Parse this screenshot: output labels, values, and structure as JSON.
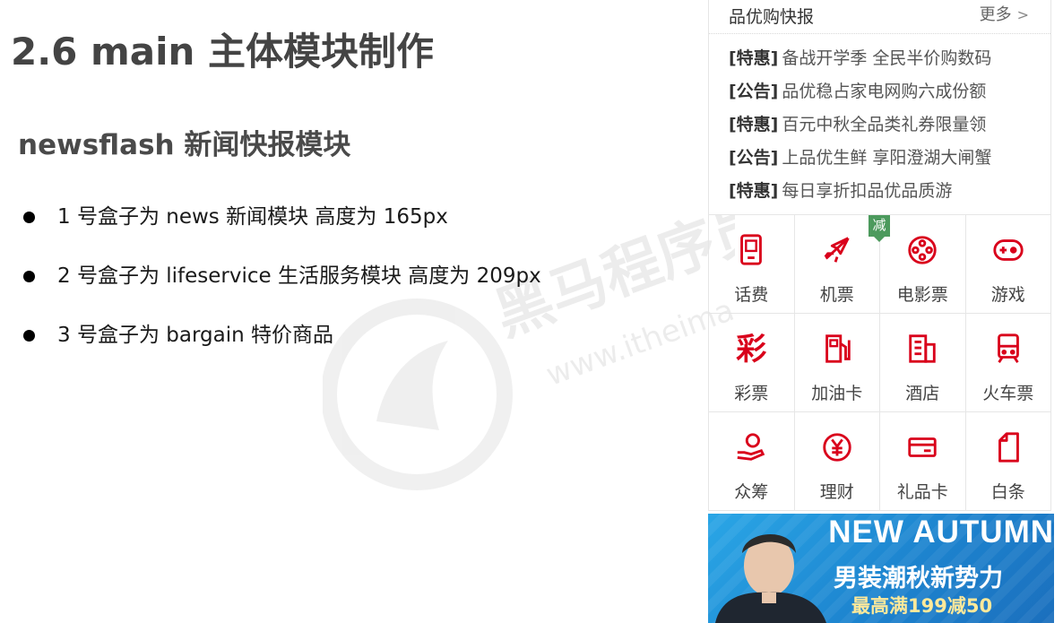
{
  "slide": {
    "title": "2.6 main 主体模块制作",
    "subtitle": "newsflash 新闻快报模块",
    "bullets": [
      "1 号盒子为 news 新闻模块  高度为 165px",
      "2 号盒子为 lifeservice 生活服务模块  高度为 209px",
      "3 号盒子为 bargain 特价商品"
    ]
  },
  "watermark": {
    "text": "黑马程序员",
    "url": "www.itheima.com"
  },
  "news": {
    "title": "品优购快报",
    "more": "更多",
    "more_icon": "chevron-right-icon",
    "items": [
      {
        "tag": "[特惠]",
        "text": "备战开学季 全民半价购数码"
      },
      {
        "tag": "[公告]",
        "text": "品优稳占家电网购六成份额"
      },
      {
        "tag": "[特惠]",
        "text": "百元中秋全品类礼券限量领"
      },
      {
        "tag": "[公告]",
        "text": "上品优生鲜 享阳澄湖大闸蟹"
      },
      {
        "tag": "[特惠]",
        "text": "每日享折扣品优品质游"
      }
    ]
  },
  "services": [
    {
      "label": "话费",
      "icon": "phone-icon"
    },
    {
      "label": "机票",
      "icon": "airplane-icon",
      "badge": "减"
    },
    {
      "label": "电影票",
      "icon": "film-reel-icon"
    },
    {
      "label": "游戏",
      "icon": "gamepad-icon"
    },
    {
      "label": "彩票",
      "icon": "lottery-icon",
      "glyph": "彩"
    },
    {
      "label": "加油卡",
      "icon": "fuel-pump-icon"
    },
    {
      "label": "酒店",
      "icon": "hotel-building-icon"
    },
    {
      "label": "火车票",
      "icon": "train-icon"
    },
    {
      "label": "众筹",
      "icon": "crowdfunding-hand-icon"
    },
    {
      "label": "理财",
      "icon": "yen-coin-icon"
    },
    {
      "label": "礼品卡",
      "icon": "gift-card-icon"
    },
    {
      "label": "白条",
      "icon": "document-icon"
    }
  ],
  "banner": {
    "headline": "NEW AUTUMN",
    "line1": "男装潮秋新势力",
    "line2": "最高满199减50"
  },
  "colors": {
    "icon_red": "#d9001b",
    "badge_green": "#4c9a5d",
    "banner_blue": "#1d84cf"
  }
}
